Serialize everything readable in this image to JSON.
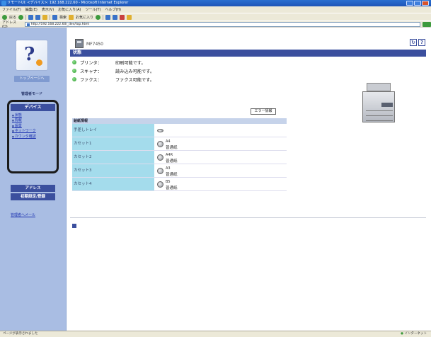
{
  "window": {
    "title": "リモートUI: <デバイス>: 192.168.222.60 - Microsoft Internet Explorer"
  },
  "menubar": {
    "items": [
      "ファイル(F)",
      "編集(E)",
      "表示(V)",
      "お気に入り(A)",
      "ツール(T)",
      "ヘルプ(H)"
    ]
  },
  "toolbar": {
    "back_label": "戻る",
    "search_label": "検索",
    "favorites_label": "お気に入り"
  },
  "address": {
    "label": "アドレス(D)",
    "url": "http://192.168.222.60/_dev/top.html"
  },
  "sidebar": {
    "portal_label": "トップページへ",
    "mode_label": "管理者モード",
    "device_heading": "デバイス",
    "links": [
      "状態",
      "情報",
      "設置",
      "ネットワーク",
      "カウンタ確認"
    ],
    "address_button": "アドレス",
    "settings_button": "初期設定/登録",
    "manager_link": "管理者へメール"
  },
  "main": {
    "device_name": "MF7450",
    "status_heading": "状態",
    "status_rows": [
      {
        "label": "プリンタ：",
        "value": "印刷可能です。"
      },
      {
        "label": "スキャナ：",
        "value": "読み込み可能です。"
      },
      {
        "label": "ファクス：",
        "value": "ファクス可能です。"
      }
    ],
    "error_button": "エラー情報",
    "paper_heading": "給紙情報",
    "trays": [
      {
        "label": "手差しトレイ",
        "size": "",
        "type": ""
      },
      {
        "label": "カセット1",
        "size": "A4",
        "type": "普通紙"
      },
      {
        "label": "カセット2",
        "size": "A4R",
        "type": "普通紙"
      },
      {
        "label": "カセット3",
        "size": "A3",
        "type": "普通紙"
      },
      {
        "label": "カセット4",
        "size": "B5",
        "type": "普通紙"
      }
    ],
    "help_icons": [
      "↻",
      "?"
    ]
  },
  "statusbar": {
    "left": "ページが表示されました",
    "zone": "インターネット"
  }
}
